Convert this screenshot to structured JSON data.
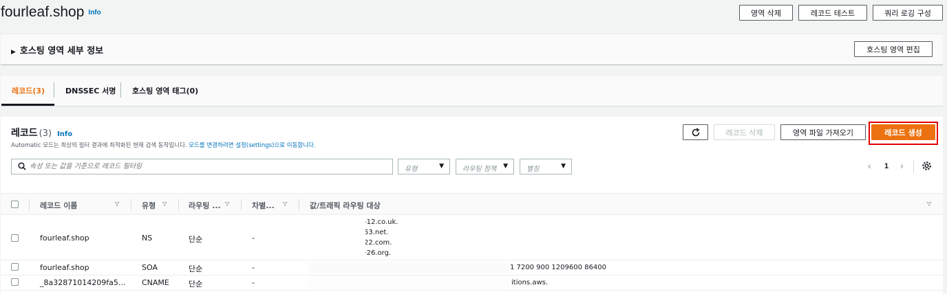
{
  "header": {
    "zone_name": "fourleaf.shop",
    "info": "Info",
    "buttons": {
      "delete_zone": "영역 삭제",
      "test_record": "레코드 테스트",
      "query_logging": "쿼리 로깅 구성"
    }
  },
  "details": {
    "title": "호스팅 영역 세부 정보",
    "edit_button": "호스팅 영역 편집"
  },
  "tabs": {
    "records": "레코드(3)",
    "dnssec": "DNSSEC 서명",
    "tags": "호스팅 영역 태그(0)"
  },
  "records": {
    "heading": "레코드",
    "count": "(3)",
    "info": "Info",
    "description": "Automatic 모드는 최상의 필터 결과에 최적화된 현재 검색 동작입니다. ",
    "description_link": "모드를 변경하려면 설정(settings)으로 이동합니다.",
    "buttons": {
      "delete_record": "레코드 삭제",
      "import_zone_file": "영역 파일 가져오기",
      "create_record": "레코드 생성"
    },
    "search_placeholder": "속성 또는 값을 기준으로 레코드 필터링",
    "filters": {
      "type": "유형",
      "routing_policy": "라우팅 정책",
      "alias": "별칭"
    },
    "pagination": {
      "page": "1"
    },
    "columns": {
      "name": "레코드 이름",
      "type": "유형",
      "routing": "라우팅 ...",
      "differentiator": "차별...",
      "value": "값/트래픽 라우팅 대상"
    },
    "rows": [
      {
        "name": "fourleaf.shop",
        "type": "NS",
        "routing": "단순",
        "differentiator": "-",
        "values": [
          "-12.co.uk.",
          "53.net.",
          "22.com.",
          "-26.org."
        ]
      },
      {
        "name": "fourleaf.shop",
        "type": "SOA",
        "routing": "단순",
        "differentiator": "-",
        "values": [
          "1 7200 900 1209600 86400"
        ]
      },
      {
        "name": "_8a32871014209fa5...",
        "type": "CNAME",
        "routing": "단순",
        "differentiator": "-",
        "values": [
          "itions.aws."
        ]
      }
    ]
  },
  "colors": {
    "accent": "#ec7211",
    "link": "#0073bb",
    "highlight_border": "#e30000"
  },
  "icons": [
    "refresh-icon",
    "search-icon",
    "chevron-left-icon",
    "chevron-right-icon",
    "settings-icon",
    "caret-down-icon",
    "expand-triangle-icon"
  ]
}
